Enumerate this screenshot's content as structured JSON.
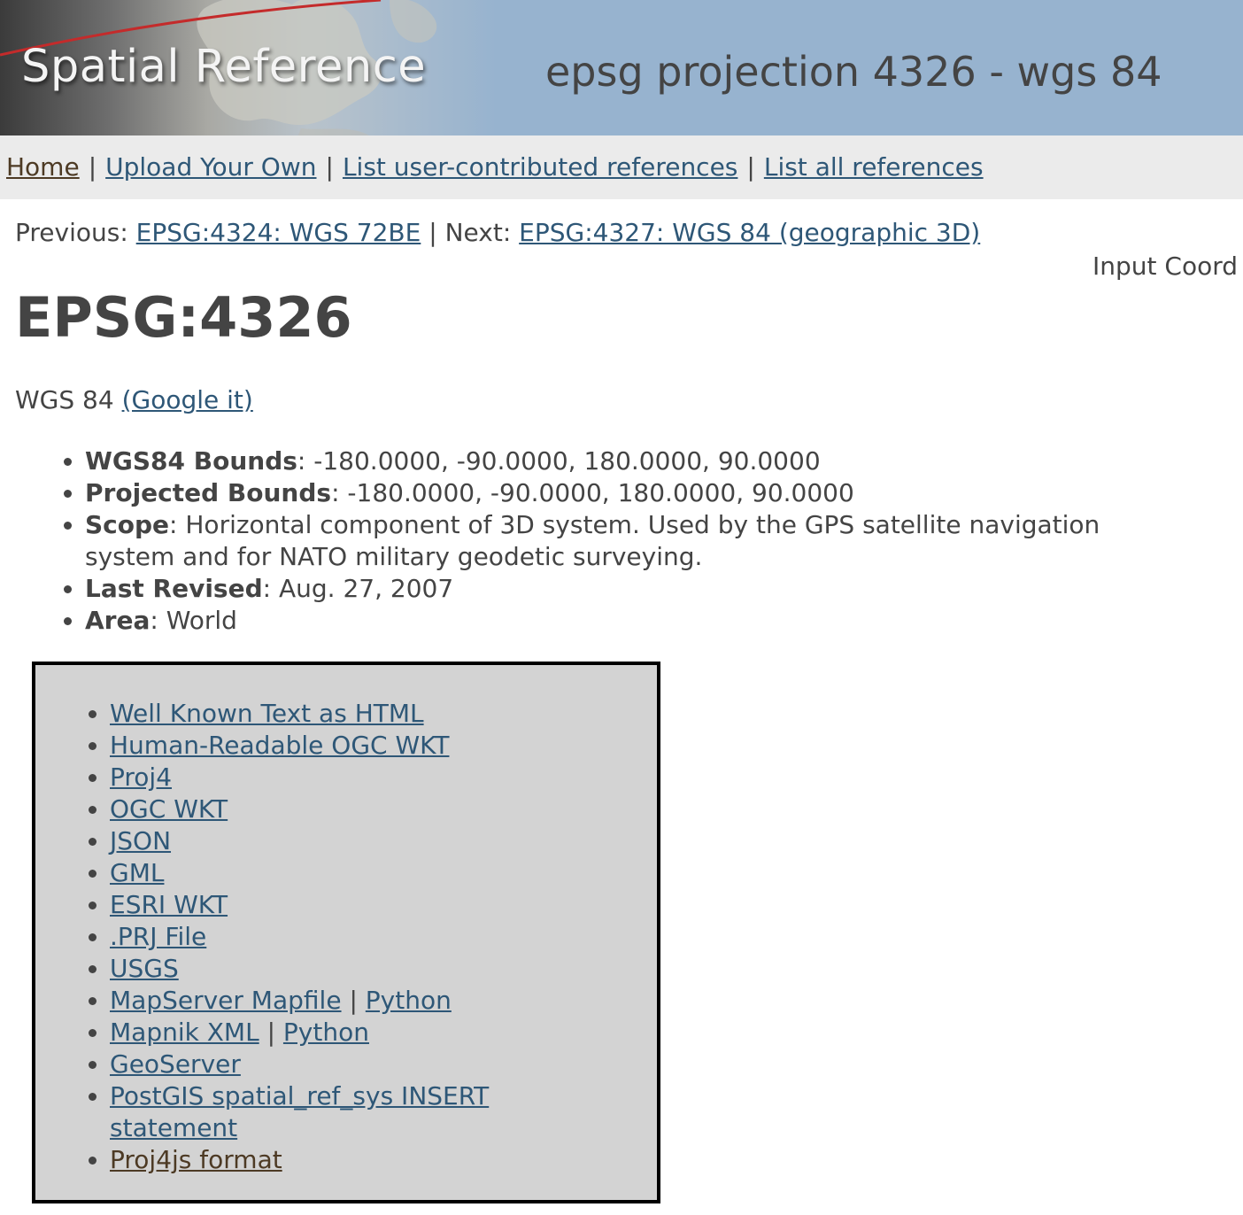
{
  "header": {
    "logo_text": "Spatial Reference",
    "page_heading": "epsg projection 4326 - wgs 84"
  },
  "nav": {
    "home": "Home",
    "upload": "Upload Your Own",
    "list_user": "List user-contributed references",
    "list_all": "List all references",
    "separator": "|"
  },
  "prevnext": {
    "previous_label": "Previous:",
    "previous_link": "EPSG:4324: WGS 72BE",
    "separator": "|",
    "next_label": "Next:",
    "next_link": "EPSG:4327: WGS 84 (geographic 3D)"
  },
  "input_coord_label": "Input Coord",
  "title": "EPSG:4326",
  "name": {
    "text": "WGS 84",
    "google_link": "(Google it)"
  },
  "properties": [
    {
      "label": "WGS84 Bounds",
      "value": ": -180.0000, -90.0000, 180.0000, 90.0000"
    },
    {
      "label": "Projected Bounds",
      "value": ": -180.0000, -90.0000, 180.0000, 90.0000"
    },
    {
      "label": "Scope",
      "value": ": Horizontal component of 3D system. Used by the GPS satellite navigation system and for NATO military geodetic surveying."
    },
    {
      "label": "Last Revised",
      "value": ": Aug. 27, 2007"
    },
    {
      "label": "Area",
      "value": ": World"
    }
  ],
  "formats": {
    "wkt_html": "Well Known Text as HTML",
    "human_wkt": "Human-Readable OGC WKT",
    "proj4": "Proj4",
    "ogc_wkt": "OGC WKT",
    "json": "JSON",
    "gml": "GML",
    "esri_wkt": "ESRI WKT",
    "prj_file": ".PRJ File",
    "usgs": "USGS",
    "mapserver": "MapServer Mapfile",
    "mapserver_python": "Python",
    "mapnik": "Mapnik XML",
    "mapnik_python": "Python",
    "geoserver": "GeoServer",
    "postgis": "PostGIS spatial_ref_sys INSERT statement",
    "proj4js": "Proj4js format",
    "separator": "|"
  }
}
